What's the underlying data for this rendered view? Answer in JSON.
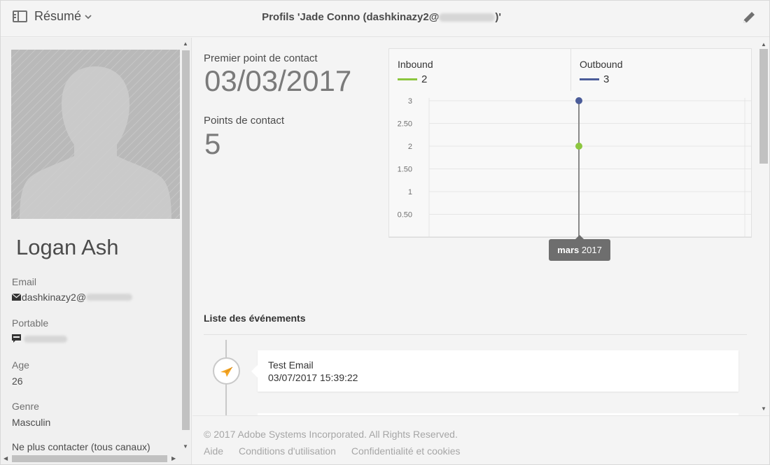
{
  "header": {
    "view_label": "Résumé",
    "title_prefix": "Profils 'Jade Conno",
    "title_email_user": "(dashkinazy2@",
    "title_suffix": ")'"
  },
  "profile": {
    "name": "Logan Ash",
    "fields": {
      "email_label": "Email",
      "email_value": "dashkinazy2@",
      "mobile_label": "Portable",
      "age_label": "Age",
      "age_value": "26",
      "gender_label": "Genre",
      "gender_value": "Masculin",
      "no_contact_label": "Ne plus contacter (tous canaux)"
    }
  },
  "kpis": {
    "first_contact_label": "Premier point de contact",
    "first_contact_value": "03/03/2017",
    "touchpoints_label": "Points de contact",
    "touchpoints_value": "5"
  },
  "chart_data": {
    "type": "scatter",
    "series": [
      {
        "name": "Inbound",
        "color": "#8cc63f",
        "x": [
          "mars 2017"
        ],
        "values": [
          2
        ]
      },
      {
        "name": "Outbound",
        "color": "#4b5c99",
        "x": [
          "mars 2017"
        ],
        "values": [
          3
        ]
      }
    ],
    "legend_values": {
      "Inbound": "2",
      "Outbound": "3"
    },
    "y_ticks": [
      "3",
      "2.50",
      "2",
      "1.50",
      "1",
      "0.50"
    ],
    "ylim": [
      0,
      3
    ],
    "grid": true,
    "legend_position": "top",
    "tooltip_month": "mars",
    "tooltip_year": "2017"
  },
  "events": {
    "section_title": "Liste des événements",
    "items": [
      {
        "title": "Test Email",
        "date": "03/07/2017 15:39:22",
        "icon": "send-icon"
      }
    ]
  },
  "footer": {
    "copyright": "© 2017 Adobe Systems Incorporated. All Rights Reserved.",
    "links": [
      "Aide",
      "Conditions d'utilisation",
      "Confidentialité et cookies"
    ]
  }
}
